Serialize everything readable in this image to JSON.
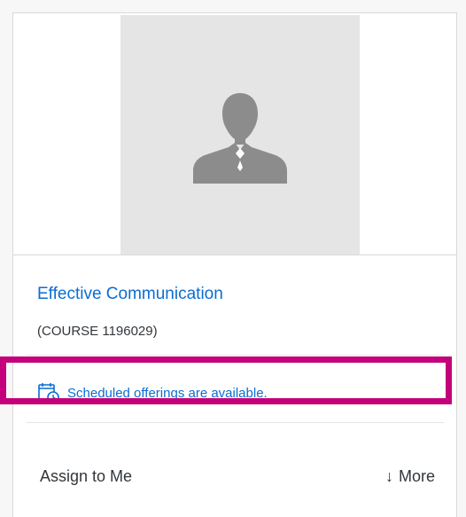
{
  "course": {
    "title": "Effective Communication",
    "id_label": "(COURSE 1196029)",
    "thumbnail_icon": "person-silhouette-icon"
  },
  "offerings": {
    "icon": "calendar-clock-icon",
    "text": "Scheduled offerings are available."
  },
  "actions": {
    "assign_label": "Assign to Me",
    "more_icon": "arrow-down-icon",
    "more_label": "More"
  },
  "colors": {
    "link": "#0a6ed1",
    "text": "#32363a",
    "highlight": "#c4007a",
    "thumb_bg": "#e5e5e5",
    "icon_gray": "#8c8c8c"
  }
}
